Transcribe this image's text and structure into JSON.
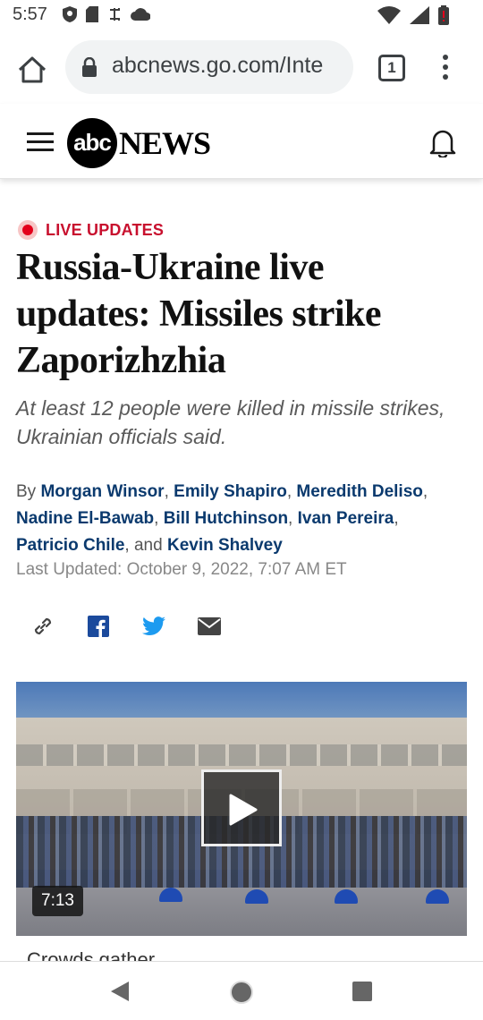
{
  "status_bar": {
    "time": "5:57",
    "icons_left": [
      "shield-icon",
      "sd-card-icon",
      "sync-icon",
      "cloud-icon"
    ],
    "icons_right": [
      "wifi-icon",
      "signal-icon",
      "battery-icon"
    ]
  },
  "browser": {
    "url": "abcnews.go.com/Inte",
    "tab_count": "1",
    "icons": [
      "home-icon",
      "lock-icon",
      "overflow-menu-icon"
    ]
  },
  "site_header": {
    "logo_mark": "abc",
    "logo_word": "NEWS",
    "icons": [
      "hamburger-menu-icon",
      "bell-icon"
    ]
  },
  "article": {
    "badge": "LIVE UPDATES",
    "headline": "Russia-Ukraine live updates: Missiles strike Zaporizhzhia",
    "dek": "At least 12 people were killed in missile strikes, Ukrainian officials said.",
    "byline_prefix": "By",
    "authors": [
      "Morgan Winsor",
      "Emily Shapiro",
      "Meredith Deliso",
      "Nadine El-Bawab",
      "Bill Hutchinson",
      "Ivan Pereira",
      "Patricio Chile",
      "Kevin Shalvey"
    ],
    "and_word": ", and",
    "updated": "Last Updated: October 9, 2022, 7:07 AM ET",
    "share_icons": [
      "link-icon",
      "facebook-icon",
      "twitter-icon",
      "email-icon"
    ]
  },
  "video": {
    "duration": "7:13",
    "caption_peek": "Crowds gather ..."
  },
  "colors": {
    "live_red": "#c8102e",
    "author_blue": "#0b3a6e",
    "bollard_blue": "#1f4bb3"
  },
  "android_nav": [
    "back-icon",
    "home-circle-icon",
    "recents-icon"
  ]
}
